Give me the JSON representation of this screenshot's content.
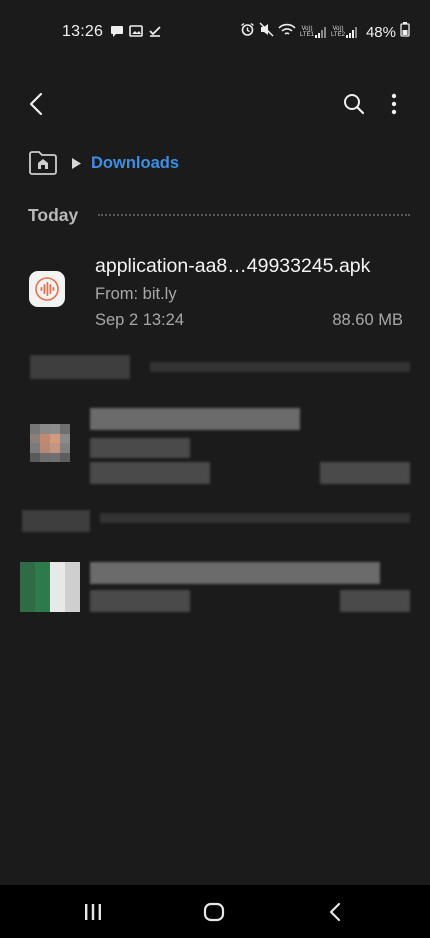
{
  "status_bar": {
    "time": "13:26",
    "battery": "48%",
    "left_icons": [
      "chat-icon",
      "image-icon",
      "check-icon"
    ],
    "right_icons": [
      "alarm-icon",
      "mute-icon",
      "wifi-icon",
      "volte-lte1-icon",
      "volte-lte2-icon",
      "battery-icon"
    ],
    "sim1_label": "Vo)) LTE1",
    "sim2_label": "Vo)) LTE2"
  },
  "app_bar": {
    "back_icon": "back-arrow-icon",
    "search_icon": "search-icon",
    "more_icon": "more-vertical-icon"
  },
  "breadcrumb": {
    "home_icon": "home-folder-icon",
    "current": "Downloads"
  },
  "sections": [
    {
      "title": "Today",
      "files": [
        {
          "name": "application-aa8…49933245.apk",
          "source": "From: bit.ly",
          "date": "Sep 2 13:24",
          "size": "88.60 MB",
          "icon": "audio-wave-app-icon"
        }
      ]
    }
  ],
  "colors": {
    "background": "#1b1b1b",
    "accent": "#3d8fe6",
    "app_icon_wave": "#e8704a",
    "nav_bar": "#000000"
  },
  "nav_bar": {
    "icons": [
      "recents-icon",
      "home-icon",
      "back-icon"
    ]
  }
}
